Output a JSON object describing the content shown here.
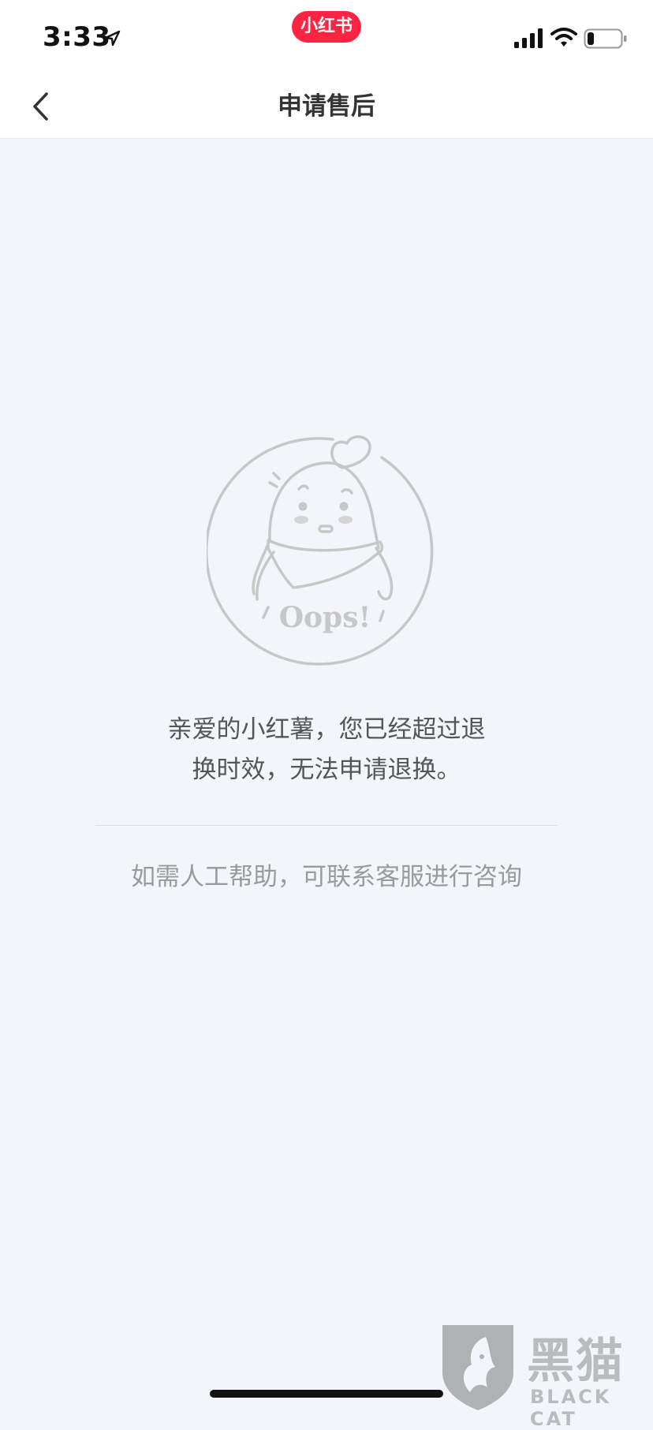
{
  "status_bar": {
    "time": "3:33",
    "app_badge": "小红书",
    "icons": [
      "location-arrow-icon",
      "cellular-signal-icon",
      "wifi-icon",
      "battery-icon"
    ],
    "battery_level": 0.2
  },
  "nav": {
    "back_icon": "chevron-left-icon",
    "title": "申请售后"
  },
  "content": {
    "illustration_text": "Oops!",
    "message_line1": "亲爱的小红薯，您已经超过退",
    "message_line2": "换时效，无法申请退换。",
    "help_text": "如需人工帮助，可联系客服进行咨询"
  },
  "watermark": {
    "cn": "黑猫",
    "en": "BLACK CAT"
  },
  "colors": {
    "brand": "#ff2442",
    "background": "#f2f5f9",
    "text_primary": "#555555",
    "text_secondary": "#9a9a9a"
  }
}
